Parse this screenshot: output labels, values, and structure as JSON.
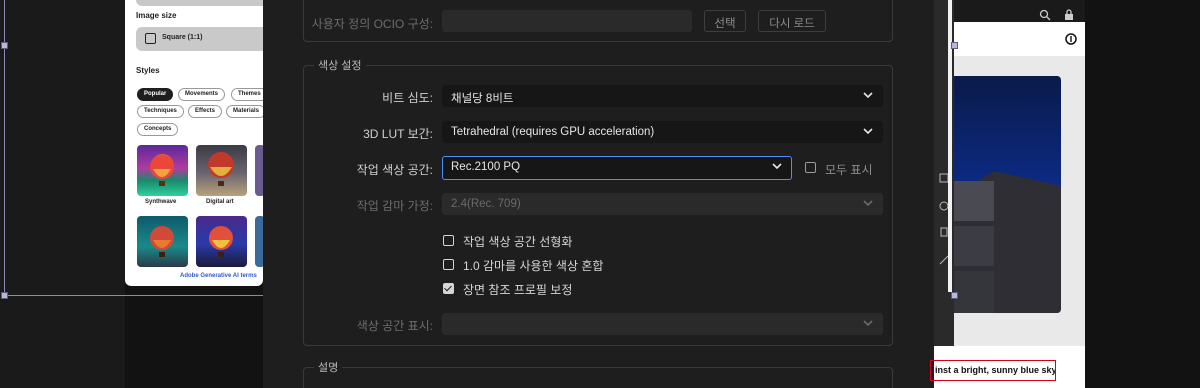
{
  "firefly_panel": {
    "image_size_heading": "Image size",
    "image_size_value": "Square (1:1)",
    "styles_heading": "Styles",
    "chips": [
      "Popular",
      "Movements",
      "Themes",
      "Techniques",
      "Effects",
      "Materials",
      "Concepts"
    ],
    "thumbnails": [
      "Synthwave",
      "Digital art"
    ],
    "footer_link": "Adobe Generative AI terms"
  },
  "dialog": {
    "ocio_config_label": "사용자 정의 OCIO 구성:",
    "ocio_config_value": "",
    "select_button": "선택",
    "reload_button": "다시 로드",
    "color_settings_legend": "색상 설정",
    "bit_depth_label": "비트 심도:",
    "bit_depth_value": "채널당 8비트",
    "lut_label": "3D LUT 보간:",
    "lut_value": "Tetrahedral (requires GPU acceleration)",
    "working_space_label": "작업 색상 공간:",
    "working_space_value": "Rec.2100 PQ",
    "show_all_label": "모두 표시",
    "show_all_checked": false,
    "gamma_label": "작업 감마 가정:",
    "gamma_value": "2.4(Rec. 709)",
    "linearize_label": "작업 색상 공간 선형화",
    "linearize_checked": false,
    "blend_label": "1.0 감마를 사용한 색상 혼합",
    "blend_checked": false,
    "scene_profile_label": "장면 참조 프로필 보정",
    "scene_profile_checked": true,
    "display_space_label": "색상 공간 표시:",
    "display_space_value": "",
    "description_legend": "설명"
  },
  "right_panel": {
    "caption": "inst a bright, sunny blue sky"
  },
  "colors": {
    "accent_focus": "#4b8ff7",
    "chip_active": "#1e1e1e",
    "caption_border": "#d0021b"
  }
}
